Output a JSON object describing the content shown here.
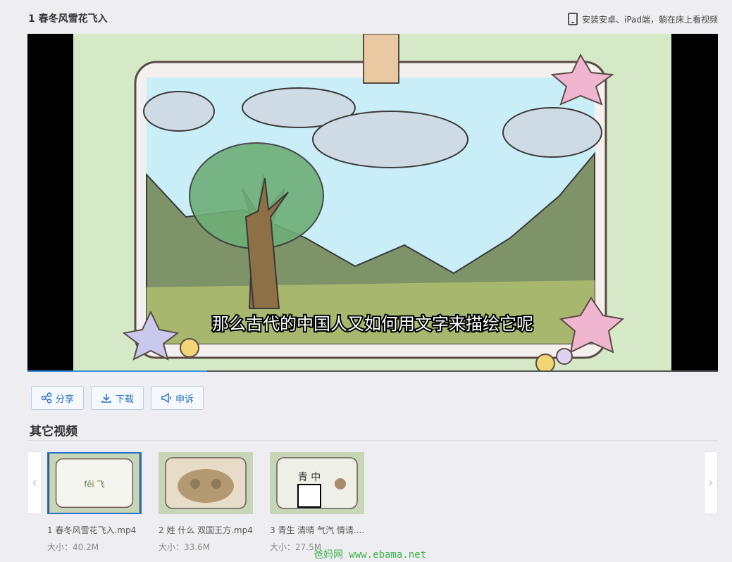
{
  "page": {
    "title": "1 春冬风雪花飞入"
  },
  "promo": {
    "icon": "tablet-icon",
    "text": "安装安卓、iPad端，躺在床上看视频"
  },
  "player": {
    "subtitle": "那么古代的中国人又如何用文字来描绘它呢",
    "progress_fraction": 0.26
  },
  "actions": {
    "share": {
      "label": "分享",
      "icon": "share-icon"
    },
    "download": {
      "label": "下载",
      "icon": "download-icon"
    },
    "report": {
      "label": "申诉",
      "icon": "megaphone-icon"
    }
  },
  "other_videos": {
    "title": "其它视频",
    "items": [
      {
        "name": "1 春冬风雪花飞入.mp4",
        "size": "大小：40.2M",
        "active": true,
        "thumb_text": "fēi 飞"
      },
      {
        "name": "2 姓 什么 双国王方.mp4",
        "size": "大小：33.6M",
        "active": false,
        "thumb_text": ""
      },
      {
        "name": "3 青生 清晴 气汽 情请....",
        "size": "大小：27.5M",
        "active": false,
        "thumb_text": "青 中"
      }
    ]
  },
  "watermark": "爸妈网 www.ebama.net",
  "colors": {
    "accent": "#2b73c4",
    "progress": "#3a8fe0",
    "watermark": "#3fb24a"
  }
}
